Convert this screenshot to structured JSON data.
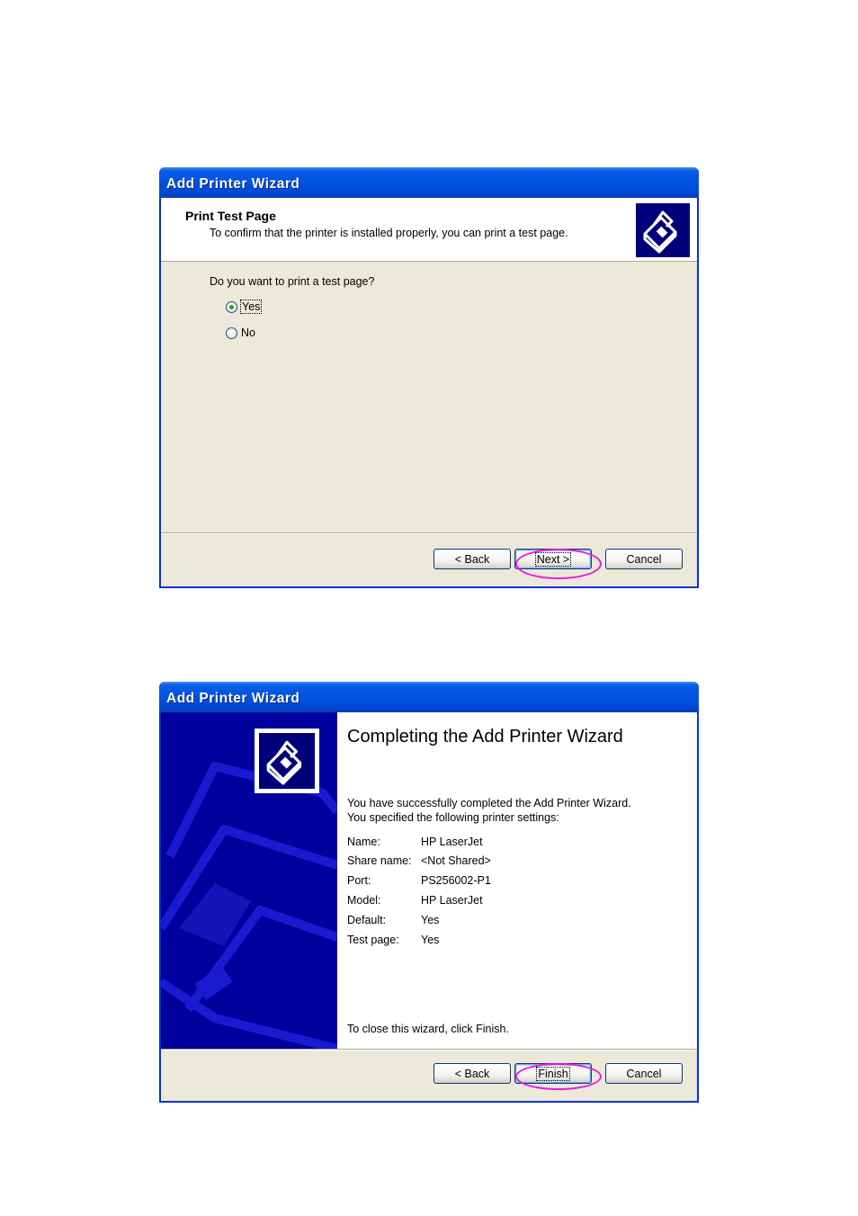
{
  "wizard1": {
    "title": "Add Printer Wizard",
    "header_title": "Print Test Page",
    "header_subtitle": "To confirm that the printer is installed properly, you can print a test page.",
    "header_icon": "printer-icon",
    "question": "Do you want to print a test page?",
    "options": [
      {
        "label": "Yes",
        "selected": true
      },
      {
        "label": "No",
        "selected": false
      }
    ],
    "buttons": {
      "back": "< Back",
      "next": "Next >",
      "cancel": "Cancel"
    }
  },
  "wizard2": {
    "title": "Add Printer Wizard",
    "heading": "Completing the Add Printer Wizard",
    "intro_line1": "You have successfully completed the Add Printer Wizard.",
    "intro_line2": "You specified the following printer settings:",
    "settings": [
      {
        "label": "Name:",
        "value": "HP LaserJet"
      },
      {
        "label": "Share name:",
        "value": "<Not Shared>"
      },
      {
        "label": "Port:",
        "value": "PS256002-P1"
      },
      {
        "label": "Model:",
        "value": "HP LaserJet"
      },
      {
        "label": "Default:",
        "value": "Yes"
      },
      {
        "label": "Test page:",
        "value": "Yes"
      }
    ],
    "closing": "To close this wizard, click Finish.",
    "side_icon": "printer-icon",
    "buttons": {
      "back": "< Back",
      "finish": "Finish",
      "cancel": "Cancel"
    }
  },
  "colors": {
    "titlebar": "#0054e3",
    "window_face": "#ece9d8",
    "side_panel": "#00009c",
    "highlight": "#e619e0"
  }
}
